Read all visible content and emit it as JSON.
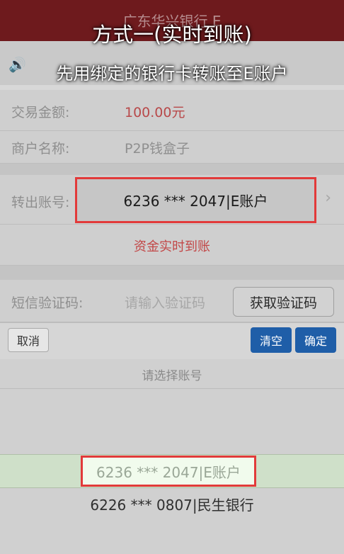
{
  "header": {
    "bank_name": "广东华兴银行 E"
  },
  "overlay": {
    "title": "方式一(实时到账)",
    "subtitle": "先用绑定的银行卡转账至E账户"
  },
  "form": {
    "amount_label": "交易金额:",
    "amount_value": "100.00元",
    "merchant_label": "商户名称:",
    "merchant_value": "P2P钱盒子",
    "account_label": "转出账号:",
    "account_value": "6236 *** 2047|E账户",
    "realtime_text": "资金实时到账",
    "sms_label": "短信验证码:",
    "sms_placeholder": "请输入验证码",
    "sms_button": "获取验证码"
  },
  "picker": {
    "cancel": "取消",
    "clear": "清空",
    "confirm": "确定",
    "title": "请选择账号",
    "options": [
      "6236 *** 2047|E账户",
      "6226 *** 0807|民生银行"
    ],
    "selected_index": 0
  },
  "icons": {
    "notice": "speaker-icon",
    "chevron": "chevron-right-icon"
  },
  "colors": {
    "header_bg": "#6e1a1d",
    "accent_red": "#e23a3a",
    "button_blue": "#1f5ea8"
  }
}
